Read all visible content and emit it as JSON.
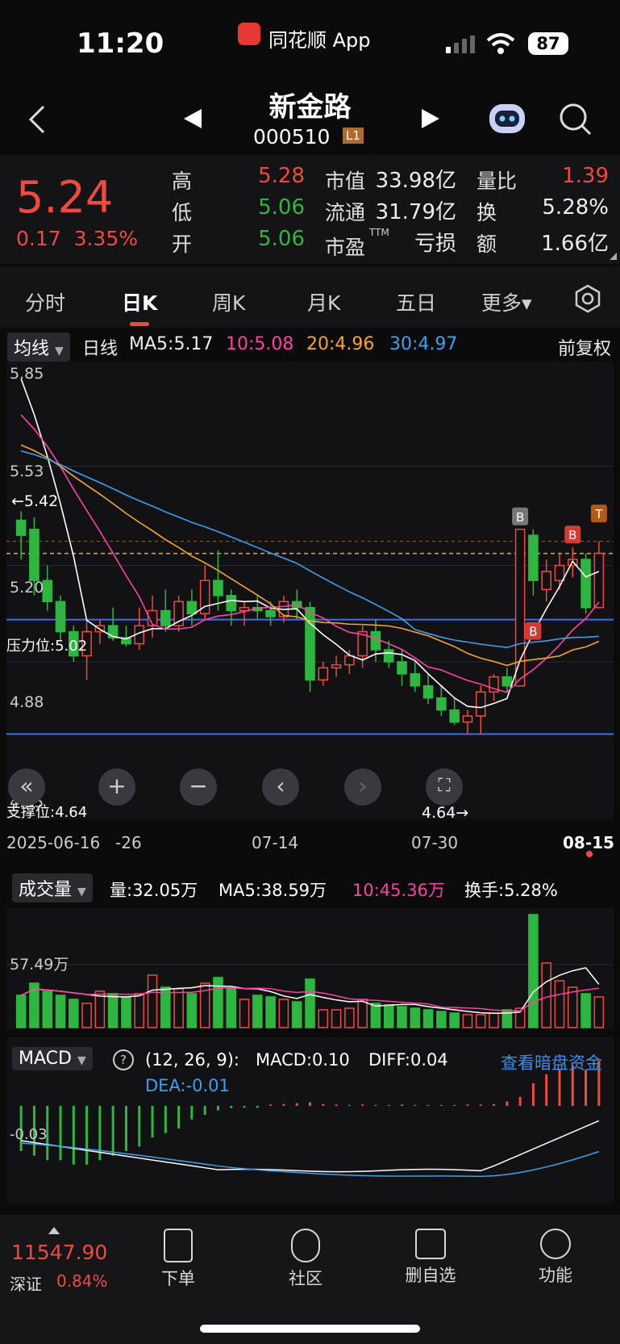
{
  "status_bar": {
    "time": "11:20",
    "app_name": "同花顺 App",
    "battery": "87"
  },
  "header": {
    "stock_name": "新金路",
    "stock_code": "000510",
    "level": "L1"
  },
  "quote": {
    "price": "5.24",
    "change": "0.17",
    "change_pct": "3.35%",
    "high_label": "高",
    "high": "5.28",
    "low_label": "低",
    "low": "5.06",
    "open_label": "开",
    "open": "5.06",
    "mktcap_label": "市值",
    "mktcap": "33.98亿",
    "float_label": "流通",
    "float": "31.79亿",
    "pe_label": "市盈",
    "pe_tag": "TTM",
    "pe": "亏损",
    "vol_ratio_label": "量比",
    "vol_ratio": "1.39",
    "turnover_label": "换",
    "turnover": "5.28%",
    "amount_label": "额",
    "amount": "1.66亿"
  },
  "tabs": [
    "分时",
    "日K",
    "周K",
    "月K",
    "五日",
    "更多▾"
  ],
  "ma_row": {
    "indicator": "均线",
    "period": "日线",
    "ma5": "MA5:5.17",
    "ma10": "10:5.08",
    "ma20": "20:4.96",
    "ma30": "30:4.97",
    "adjust": "前复权",
    "colors": {
      "ma5": "#ffffff",
      "ma10": "#ff3fa4",
      "ma20": "#f5a623",
      "ma30": "#3aa0f0"
    }
  },
  "kline": {
    "y_high_label": "5.85",
    "y_labels": [
      "5.53",
      "5.20",
      "4.88"
    ],
    "y_bottom_label": "4.55",
    "high_marker": "←5.42",
    "low_marker": "4.64→",
    "resistance": "压力位:5.02",
    "support": "支撑位:4.64",
    "x_labels": [
      "2025-06-16",
      "-26",
      "07-14",
      "07-30",
      "08-15"
    ],
    "signals": [
      "B",
      "B",
      "B",
      "T"
    ]
  },
  "chart_data": {
    "type": "candlestick",
    "y_range": [
      4.55,
      5.85
    ],
    "x_start": "2025-06-16",
    "x_end": "2025-08-15",
    "resistance": 5.02,
    "support": 4.64,
    "ohlc": [
      [
        5.35,
        5.38,
        5.22,
        5.3
      ],
      [
        5.32,
        5.36,
        5.1,
        5.15
      ],
      [
        5.15,
        5.2,
        5.05,
        5.08
      ],
      [
        5.08,
        5.1,
        4.95,
        4.98
      ],
      [
        4.98,
        5.0,
        4.88,
        4.9
      ],
      [
        4.9,
        5.02,
        4.82,
        4.98
      ],
      [
        4.98,
        5.02,
        4.94,
        5.0
      ],
      [
        5.0,
        5.06,
        4.95,
        4.96
      ],
      [
        4.96,
        5.0,
        4.93,
        4.94
      ],
      [
        4.94,
        5.06,
        4.92,
        5.0
      ],
      [
        5.0,
        5.1,
        4.96,
        5.05
      ],
      [
        5.05,
        5.12,
        4.98,
        5.0
      ],
      [
        5.0,
        5.1,
        4.98,
        5.08
      ],
      [
        5.08,
        5.12,
        5.0,
        5.04
      ],
      [
        5.04,
        5.2,
        5.02,
        5.15
      ],
      [
        5.15,
        5.25,
        5.05,
        5.1
      ],
      [
        5.1,
        5.12,
        5.0,
        5.05
      ],
      [
        5.05,
        5.08,
        5.0,
        5.06
      ],
      [
        5.06,
        5.1,
        5.02,
        5.05
      ],
      [
        5.05,
        5.08,
        5.0,
        5.03
      ],
      [
        5.03,
        5.1,
        5.01,
        5.08
      ],
      [
        5.08,
        5.12,
        5.02,
        5.06
      ],
      [
        5.06,
        5.08,
        4.78,
        4.82
      ],
      [
        4.82,
        4.88,
        4.8,
        4.86
      ],
      [
        4.86,
        4.9,
        4.83,
        4.87
      ],
      [
        4.87,
        4.92,
        4.84,
        4.9
      ],
      [
        4.9,
        5.0,
        4.86,
        4.98
      ],
      [
        4.98,
        5.02,
        4.88,
        4.92
      ],
      [
        4.92,
        4.95,
        4.86,
        4.88
      ],
      [
        4.88,
        4.92,
        4.8,
        4.84
      ],
      [
        4.84,
        4.88,
        4.78,
        4.8
      ],
      [
        4.8,
        4.84,
        4.74,
        4.76
      ],
      [
        4.76,
        4.8,
        4.7,
        4.72
      ],
      [
        4.72,
        4.76,
        4.67,
        4.68
      ],
      [
        4.68,
        4.72,
        4.64,
        4.7
      ],
      [
        4.7,
        4.8,
        4.64,
        4.78
      ],
      [
        4.78,
        4.84,
        4.75,
        4.83
      ],
      [
        4.83,
        4.86,
        4.78,
        4.8
      ],
      [
        4.8,
        5.32,
        4.8,
        5.32
      ],
      [
        5.3,
        5.32,
        5.1,
        5.15
      ],
      [
        5.12,
        5.22,
        5.08,
        5.18
      ],
      [
        5.15,
        5.24,
        5.12,
        5.2
      ],
      [
        5.2,
        5.26,
        5.16,
        5.22
      ],
      [
        5.22,
        5.24,
        5.04,
        5.06
      ],
      [
        5.06,
        5.28,
        5.06,
        5.24
      ]
    ],
    "volume": {
      "label": "成交量",
      "vol": "量:32.05万",
      "ma5": "MA5:38.59万",
      "ma10": "10:45.36万",
      "turnover": "换手:5.28%",
      "y_label": "57.49万",
      "values": [
        40,
        55,
        45,
        40,
        35,
        30,
        45,
        42,
        38,
        42,
        65,
        50,
        48,
        42,
        55,
        62,
        48,
        35,
        40,
        38,
        35,
        32,
        60,
        22,
        22,
        24,
        35,
        30,
        28,
        26,
        24,
        22,
        20,
        18,
        16,
        16,
        18,
        22,
        24,
        140,
        80,
        58,
        50,
        42,
        38
      ]
    },
    "macd": {
      "label": "MACD",
      "params": "(12, 26, 9):",
      "macd": "MACD:0.10",
      "diff": "DIFF:0.04",
      "dea": "DEA:-0.01",
      "link": "查看暗盘资金",
      "y_label": "-0.03",
      "hist": [
        -0.1,
        -0.11,
        -0.12,
        -0.12,
        -0.13,
        -0.13,
        -0.12,
        -0.11,
        -0.1,
        -0.09,
        -0.07,
        -0.06,
        -0.05,
        -0.03,
        -0.02,
        -0.01,
        -0.005,
        -0.004,
        -0.004,
        0.003,
        0.004,
        0.006,
        0.008,
        0.004,
        0.003,
        0.002,
        0.003,
        0.002,
        0.002,
        0.003,
        0.002,
        0.002,
        0.002,
        0.002,
        0.003,
        0.003,
        0.004,
        0.01,
        0.02,
        0.05,
        0.07,
        0.08,
        0.09,
        0.08,
        0.1
      ]
    }
  },
  "bottom_nav": {
    "index_value": "11547.90",
    "index_name": "深证",
    "index_pct": "0.84%",
    "items": [
      "下单",
      "社区",
      "删自选",
      "功能"
    ]
  }
}
